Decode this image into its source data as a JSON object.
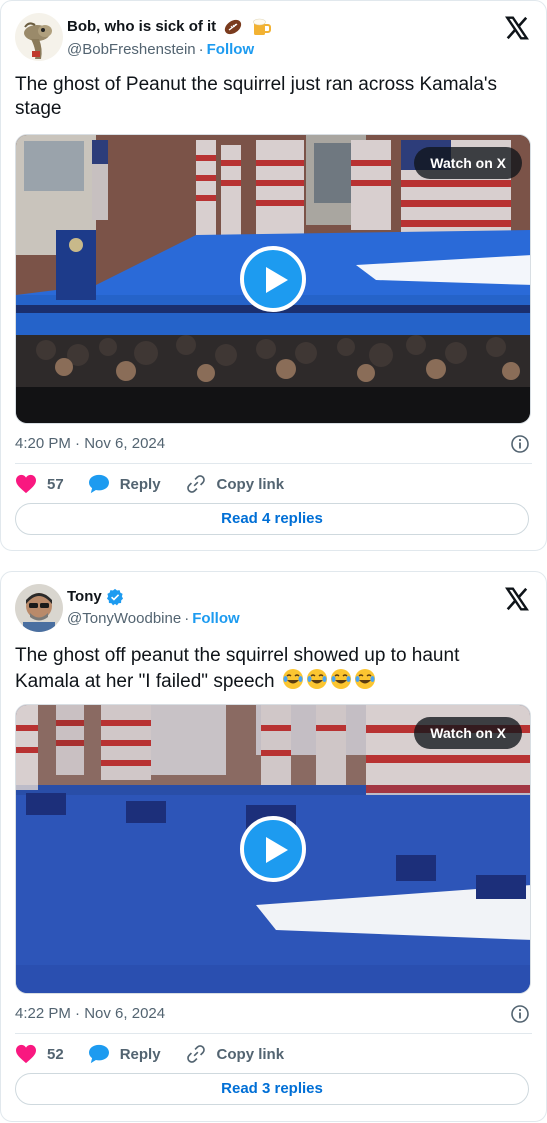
{
  "tweets": [
    {
      "display_name": "Bob, who is sick of it",
      "name_emojis": [
        "football-icon",
        "beer-mug-icon"
      ],
      "handle": "@BobFreshenstein",
      "separator": "·",
      "follow_label": "Follow",
      "text": "The ghost of Peanut the squirrel just ran across Kamala's stage",
      "watch_label": "Watch on X",
      "time": "4:20 PM",
      "date": "Nov 6, 2024",
      "likes": "57",
      "reply_label": "Reply",
      "copy_label": "Copy link",
      "read_replies_label": "Read 4 replies",
      "verified": false
    },
    {
      "display_name": "Tony",
      "handle": "@TonyWoodbine",
      "separator": "·",
      "follow_label": "Follow",
      "text": "The ghost off peanut the squirrel showed up to haunt Kamala at her \"I failed\" speech",
      "text_emojis": [
        "face-with-tears-of-joy-icon",
        "face-with-tears-of-joy-icon",
        "face-with-tears-of-joy-icon",
        "face-with-tears-of-joy-icon"
      ],
      "watch_label": "Watch on X",
      "time": "4:22 PM",
      "date": "Nov 6, 2024",
      "likes": "52",
      "reply_label": "Reply",
      "copy_label": "Copy link",
      "read_replies_label": "Read 3 replies",
      "verified": true
    }
  ],
  "colors": {
    "accent": "#1d9bf0",
    "like": "#f91880",
    "link": "#006fd6",
    "stage_blue": "#2563c9"
  }
}
